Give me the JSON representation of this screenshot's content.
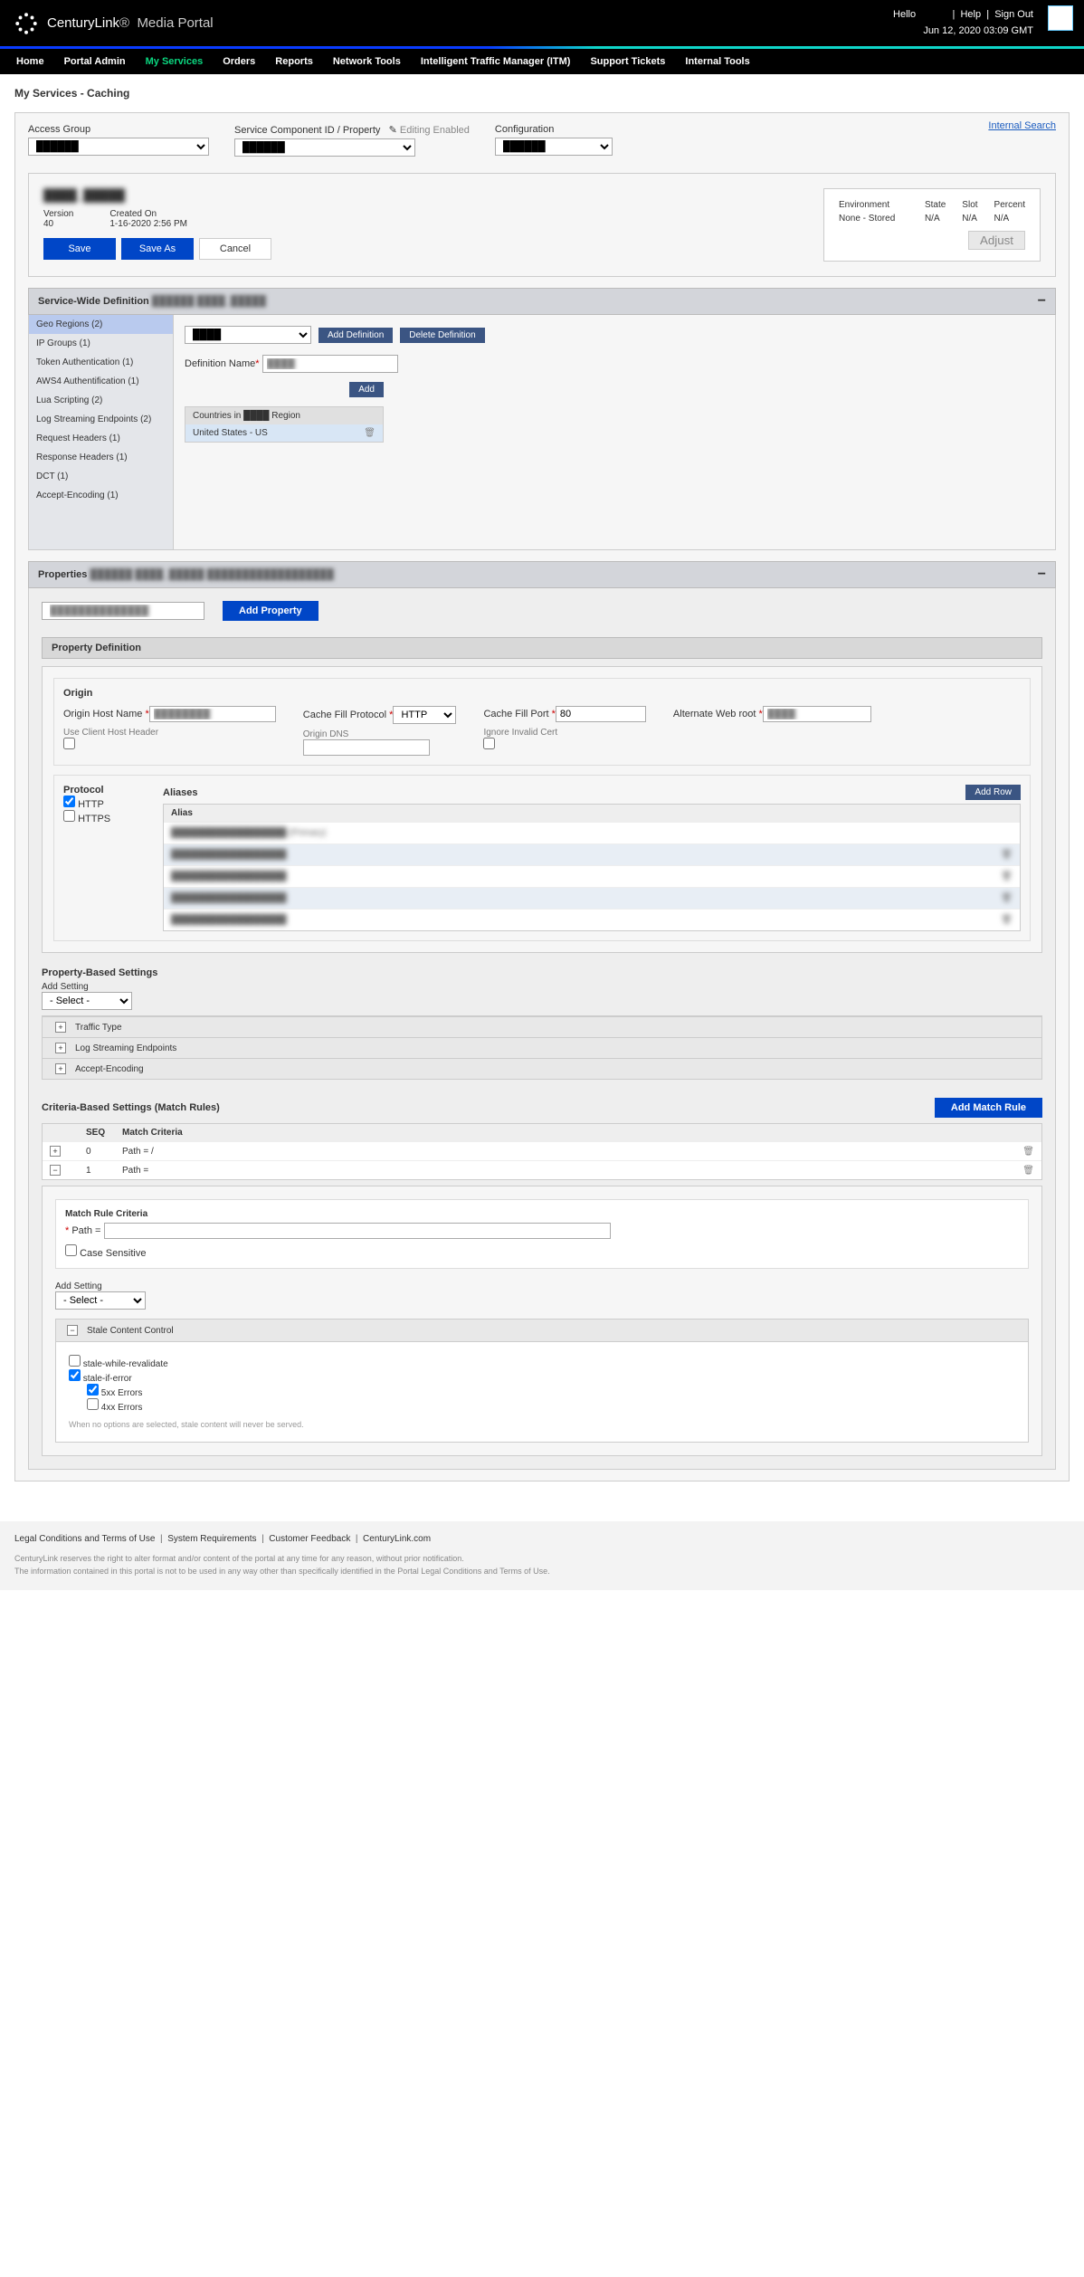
{
  "header": {
    "brand": "CenturyLink",
    "portal": "Media Portal",
    "hello": "Hello",
    "user": "████",
    "help": "Help",
    "signout": "Sign Out",
    "timestamp": "Jun 12, 2020 03:09 GMT"
  },
  "nav": [
    "Home",
    "Portal Admin",
    "My Services",
    "Orders",
    "Reports",
    "Network Tools",
    "Intelligent Traffic Manager (ITM)",
    "Support Tickets",
    "Internal Tools"
  ],
  "crumb": "My Services - Caching",
  "search": "Internal Search",
  "filters": {
    "access": "Access Group",
    "svc": "Service Component ID / Property",
    "edit": "Editing Enabled",
    "conf": "Configuration"
  },
  "svc": {
    "version_l": "Version",
    "version": "40",
    "created_l": "Created On",
    "created": "1-16-2020 2:56 PM",
    "save": "Save",
    "saveas": "Save As",
    "cancel": "Cancel"
  },
  "env": {
    "env_l": "Environment",
    "env": "None - Stored",
    "state_l": "State",
    "state": "N/A",
    "slot_l": "Slot",
    "slot": "N/A",
    "pct_l": "Percent",
    "pct": "N/A",
    "adjust": "Adjust"
  },
  "sw": {
    "title": "Service-Wide Definition",
    "toggle": "−",
    "side": [
      "Geo Regions (2)",
      "IP Groups (1)",
      "Token Authentication (1)",
      "AWS4 Authentification (1)",
      "Lua Scripting (2)",
      "Log Streaming Endpoints (2)",
      "Request Headers (1)",
      "Response Headers (1)",
      "DCT (1)",
      "Accept-Encoding (1)"
    ],
    "adddef": "Add Definition",
    "deldef": "Delete Definition",
    "defname_l": "Definition Name",
    "add": "Add",
    "ctry_hdr": "Countries in ████ Region",
    "ctry": "United States - US"
  },
  "props": {
    "title": "Properties",
    "toggle": "−",
    "addprop": "Add Property"
  },
  "propdef": {
    "title": "Property Definition",
    "origin": "Origin",
    "ohn": "Origin Host Name",
    "cfp": "Cache Fill Protocol",
    "cfp_v": "HTTP",
    "cfport": "Cache Fill Port",
    "cfport_v": "80",
    "awr": "Alternate Web root",
    "uchh": "Use Client Host Header",
    "odns": "Origin DNS",
    "iic": "Ignore Invalid Cert",
    "proto": "Protocol",
    "http": "HTTP",
    "https": "HTTPS",
    "aliases": "Aliases",
    "addrow": "Add Row",
    "alias_col": "Alias",
    "alias_rows": [
      "██████████████████ (Primary)",
      "██████████████████",
      "██████████████████",
      "██████████████████",
      "██████████████████"
    ]
  },
  "pbs": {
    "title": "Property-Based Settings",
    "addset": "Add Setting",
    "select": "- Select -",
    "rows": [
      "Traffic Type",
      "Log Streaming Endpoints",
      "Accept-Encoding"
    ]
  },
  "crit": {
    "title": "Criteria-Based Settings (Match Rules)",
    "addrule": "Add Match Rule",
    "seq": "SEQ",
    "mc": "Match Criteria",
    "rows": [
      {
        "seq": "0",
        "mc": "Path = /"
      },
      {
        "seq": "1",
        "mc": "Path ="
      }
    ],
    "mrc": "Match Rule Criteria",
    "path": "Path =",
    "cs": "Case Sensitive",
    "addset": "Add Setting",
    "select": "- Select -"
  },
  "stale": {
    "title": "Stale Content Control",
    "swr": "stale-while-revalidate",
    "sie": "stale-if-error",
    "e5": "5xx Errors",
    "e4": "4xx Errors",
    "note": "When no options are selected, stale content will never be served."
  },
  "footer": {
    "links": [
      "Legal Conditions and Terms of Use",
      "System Requirements",
      "Customer Feedback",
      "CenturyLink.com"
    ],
    "l1": "CenturyLink reserves the right to alter format and/or content of the portal at any time for any reason, without prior notification.",
    "l2": "The information contained in this portal is not to be used in any way other than specifically identified in the Portal Legal Conditions and Terms of Use."
  }
}
